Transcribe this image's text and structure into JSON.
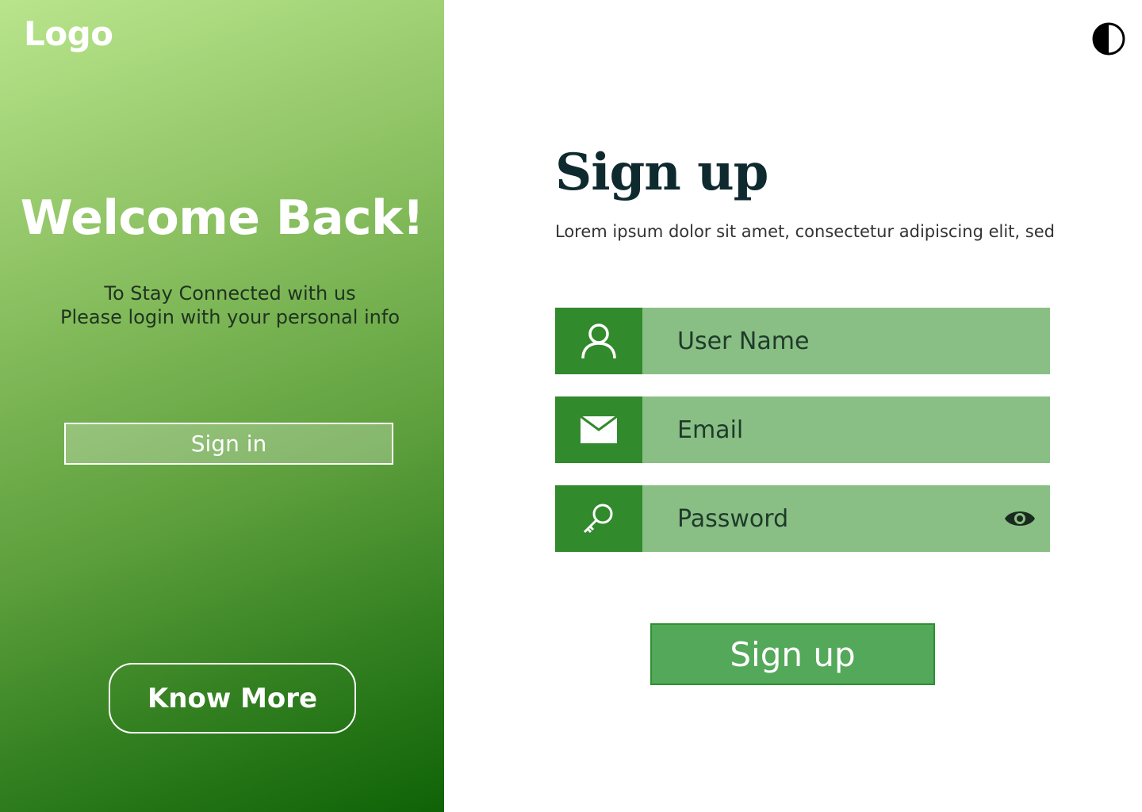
{
  "colors": {
    "panel_gradient_start": "#b9e58c",
    "panel_gradient_end": "#0f6306",
    "field_bg": "#89bf85",
    "icon_box_bg": "#318a2b",
    "submit_bg": "#54a85a",
    "title_color": "#0e2a2e"
  },
  "left_panel": {
    "logo": "Logo",
    "welcome": "Welcome Back!",
    "tagline_line1": "To Stay Connected with us",
    "tagline_line2": "Please login with your personal info",
    "signin_label": "Sign in",
    "know_more_label": "Know More"
  },
  "header": {
    "theme_toggle_icon": "contrast-icon"
  },
  "form": {
    "title": "Sign up",
    "subtitle": "Lorem ipsum dolor sit amet, consectetur adipiscing elit, sed",
    "fields": [
      {
        "icon": "user-icon",
        "placeholder": "User Name"
      },
      {
        "icon": "mail-icon",
        "placeholder": "Email"
      },
      {
        "icon": "key-icon",
        "placeholder": "Password",
        "trailing_icon": "eye-icon"
      }
    ],
    "submit_label": "Sign up"
  }
}
